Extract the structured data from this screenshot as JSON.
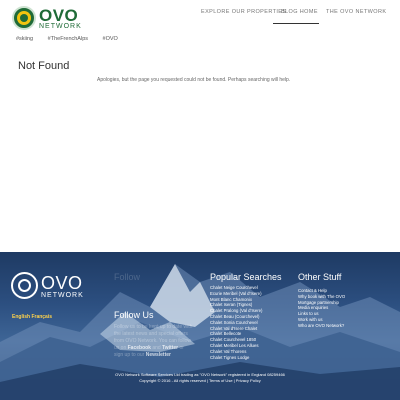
{
  "header": {
    "logo": {
      "name": "OVO",
      "sub": "NETWORK"
    },
    "nav": [
      {
        "label": "EXPLORE OUR PROPERTIES",
        "active": false
      },
      {
        "label": "BLOG HOME",
        "active": true
      },
      {
        "label": "THE OVO NETWORK",
        "active": false
      }
    ],
    "tags": [
      "#skiing",
      "#TheFrenchAlps",
      "#OVO"
    ]
  },
  "main": {
    "title": "Not Found",
    "message": "Apologies, but the page you requested could not be found. Perhaps searching will help."
  },
  "footer": {
    "logo": {
      "name": "OVO",
      "sub": "NETWORK"
    },
    "language_link": "English Français",
    "ghost_title": "Follow",
    "follow": {
      "title": "Follow Us",
      "text_before": "Follow us to be kept up to date with the latest news and special offers from OVO Network. You can follow us on",
      "facebook": "Facebook",
      "mid": "and",
      "twitter": "Twitter",
      "after": "or sign up to our",
      "newsletter": "Newsletter"
    },
    "popular": {
      "title": "Popular Searches",
      "items": [
        "Chalet Neige Courchevel",
        "Ecurie Meribel (Val d’Isere)",
        "Mont Blanc Chamonix",
        "Chalet Iseran (Tignes)",
        "Chalet Pralong (Val d’Isere)",
        "Chalet Beau (Courchevel)",
        "Chalet Sonia Courchevel",
        "Chalet Val d’Isere Chalet",
        "Chalet Bellecote",
        "Chalet Courchevel 1850",
        "Chalet Meribel Les Allues",
        "Chalet Val Thorens",
        "Chalet Tignes Lodge"
      ]
    },
    "other": {
      "title": "Other Stuff",
      "items": [
        "Contact & Help",
        "Why book with The OVO",
        "Mortgage partnership",
        "Media enquiries",
        "Links to us",
        "Work with us",
        "Who are OVO Network?"
      ]
    },
    "legal": {
      "line1": "OVO Network Software Services Ltd trading as \"OVO Network\" registered in England 08259466",
      "line2": "Copyright © 2016 - All rights reserved | Terms of Use | Privacy Policy"
    }
  }
}
